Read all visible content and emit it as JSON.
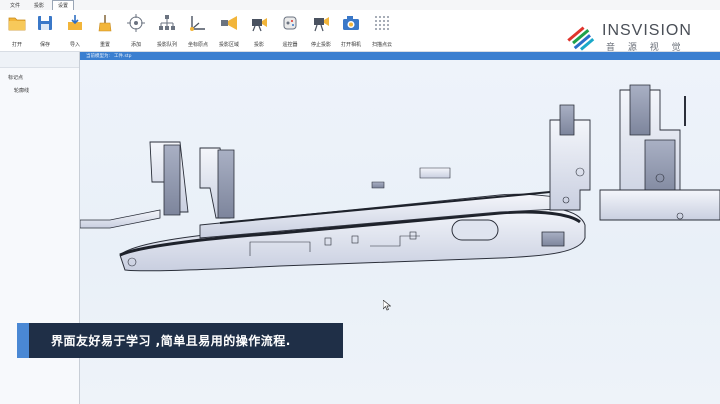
{
  "menu": {
    "items": [
      {
        "label": "文件"
      },
      {
        "label": "投影"
      },
      {
        "label": "设置"
      }
    ]
  },
  "toolbar": {
    "items": [
      {
        "label": "打开",
        "icon": "folder-icon"
      },
      {
        "label": "保存",
        "icon": "save-icon"
      },
      {
        "label": "导入",
        "icon": "import-icon"
      },
      {
        "label": "重置",
        "icon": "broom-icon"
      },
      {
        "label": "添加",
        "icon": "add-point-icon"
      },
      {
        "label": "投影队列",
        "icon": "projection-queue-icon"
      },
      {
        "label": "坐标原点",
        "icon": "origin-icon"
      },
      {
        "label": "投影区域",
        "icon": "projection-area-icon"
      },
      {
        "label": "投影",
        "icon": "projector-icon"
      },
      {
        "label": "遥控器",
        "icon": "remote-icon"
      },
      {
        "label": "停止投影",
        "icon": "stop-projection-icon"
      },
      {
        "label": "打开相机",
        "icon": "camera-icon"
      },
      {
        "label": "扫描点云",
        "icon": "point-cloud-icon"
      }
    ]
  },
  "brand": {
    "name": "INSVISION",
    "subtitle": "音 源 视 觉",
    "colors": [
      "#e0342c",
      "#1fa24a",
      "#2a6fc9",
      "#1aa8c8"
    ]
  },
  "breadcrumb": {
    "items": [
      "当前模型为:",
      "工件.stp"
    ]
  },
  "sidebar": {
    "tree": [
      {
        "label": "标记点",
        "level": 0
      },
      {
        "label": "轮廓线",
        "level": 1
      }
    ]
  },
  "caption": {
    "text": "界面友好易于学习 ,简单且易用的操作流程."
  },
  "accent_color": "#3b7fd0"
}
